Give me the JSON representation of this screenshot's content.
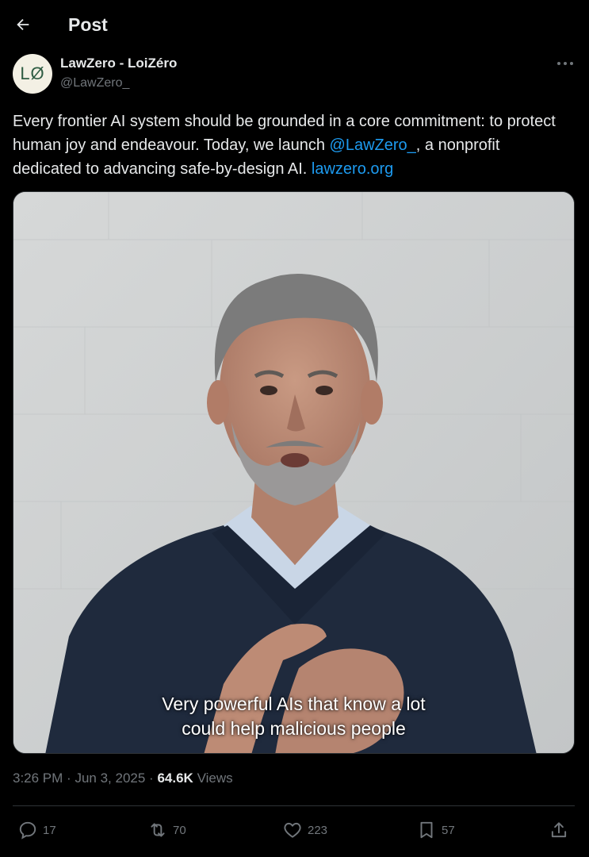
{
  "header": {
    "title": "Post",
    "back_icon": "arrow-left-icon"
  },
  "author": {
    "avatar_text": "LØ",
    "display_name": "LawZero - LoiZéro",
    "handle": "@LawZero_"
  },
  "post": {
    "text_part1": "Every frontier AI system should be grounded in a core commitment: to protect human joy and endeavour. Today, we launch ",
    "mention": "@LawZero_",
    "text_part2": ", a nonprofit dedicated to advancing safe-by-design AI. ",
    "link": "lawzero.org"
  },
  "media": {
    "caption_line1": "Very powerful AIs that know a lot",
    "caption_line2": "could help malicious people"
  },
  "meta": {
    "time": "3:26 PM",
    "separator": "·",
    "date": "Jun 3, 2025",
    "views_count": "64.6K",
    "views_label": "Views"
  },
  "actions": {
    "replies": "17",
    "reposts": "70",
    "likes": "223",
    "bookmarks": "57"
  },
  "colors": {
    "background": "#000000",
    "text": "#e7e9ea",
    "secondary": "#71767b",
    "accent": "#1d9bf0"
  }
}
